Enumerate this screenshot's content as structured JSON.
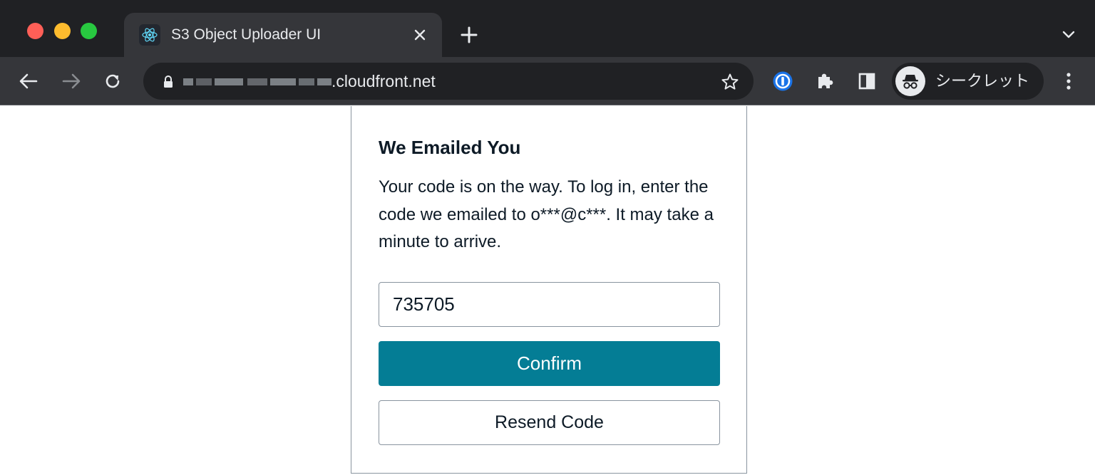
{
  "browser": {
    "tab": {
      "title": "S3 Object Uploader UI",
      "favicon": "react-icon"
    },
    "address_bar": {
      "url_visible": ".cloudfront.net"
    },
    "incognito_label": "シークレット"
  },
  "auth": {
    "heading": "We Emailed You",
    "message": "Your code is on the way. To log in, enter the code we emailed to o***@c***. It may take a minute to arrive.",
    "code_value": "735705",
    "confirm_label": "Confirm",
    "resend_label": "Resend Code"
  },
  "colors": {
    "primary_button": "#047d95",
    "border": "#89949f",
    "text": "#0d1a26",
    "chrome_dark": "#202124",
    "chrome_toolbar": "#35363a"
  }
}
